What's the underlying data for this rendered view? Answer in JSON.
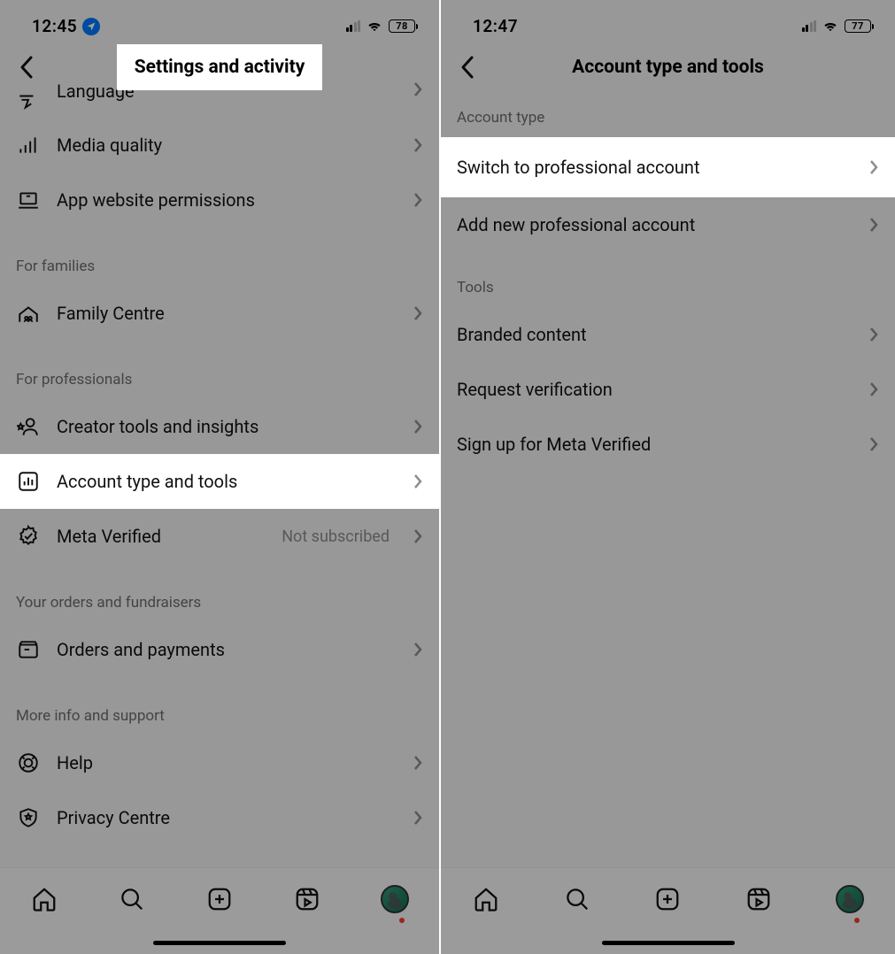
{
  "left": {
    "status": {
      "time": "12:45",
      "battery": "78"
    },
    "title": "Settings and activity",
    "rows_top": [
      {
        "id": "language",
        "icon": "globe",
        "label": "Language"
      },
      {
        "id": "media-quality",
        "icon": "signal",
        "label": "Media quality"
      },
      {
        "id": "app-website-permissions",
        "icon": "laptop",
        "label": "App website permissions"
      }
    ],
    "sections": [
      {
        "header": "For families",
        "items": [
          {
            "id": "family-centre",
            "icon": "family",
            "label": "Family Centre"
          }
        ]
      },
      {
        "header": "For professionals",
        "items": [
          {
            "id": "creator-tools",
            "icon": "star-user",
            "label": "Creator tools and insights"
          },
          {
            "id": "account-type-tools",
            "icon": "chart-square",
            "label": "Account type and tools",
            "highlight": true
          },
          {
            "id": "meta-verified",
            "icon": "badge-check",
            "label": "Meta Verified",
            "value": "Not subscribed"
          }
        ]
      },
      {
        "header": "Your orders and fundraisers",
        "items": [
          {
            "id": "orders-payments",
            "icon": "box",
            "label": "Orders and payments"
          }
        ]
      },
      {
        "header": "More info and support",
        "items": [
          {
            "id": "help",
            "icon": "lifebuoy",
            "label": "Help"
          },
          {
            "id": "privacy-centre",
            "icon": "shield-star",
            "label": "Privacy Centre"
          }
        ]
      }
    ]
  },
  "right": {
    "status": {
      "time": "12:47",
      "battery": "77"
    },
    "title": "Account type and tools",
    "sections": [
      {
        "header": "Account type",
        "items": [
          {
            "id": "switch-professional",
            "label": "Switch to professional account",
            "highlight": true
          },
          {
            "id": "add-professional",
            "label": "Add new professional account"
          }
        ]
      },
      {
        "header": "Tools",
        "items": [
          {
            "id": "branded-content",
            "label": "Branded content"
          },
          {
            "id": "request-verification",
            "label": "Request verification"
          },
          {
            "id": "meta-verified-signup",
            "label": "Sign up for Meta Verified"
          }
        ]
      }
    ]
  }
}
